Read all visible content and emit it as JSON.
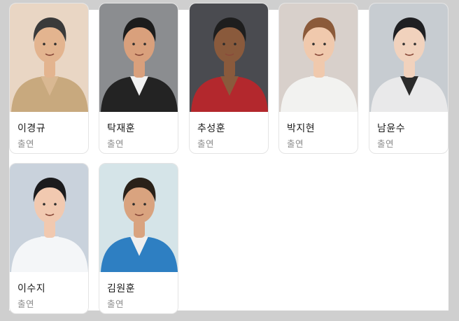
{
  "cast": [
    {
      "name": "이경규",
      "role": "출연",
      "colors": {
        "bg": "#e9d6c4",
        "skin": "#e3b48f",
        "hair": "#3a3a3a",
        "top": "#c8a97e",
        "inner": "#d9b892"
      }
    },
    {
      "name": "탁재훈",
      "role": "출연",
      "colors": {
        "bg": "#8b8d90",
        "skin": "#d9a07c",
        "hair": "#1c1c1c",
        "top": "#232323",
        "inner": "#f1f1f1"
      }
    },
    {
      "name": "추성훈",
      "role": "출연",
      "colors": {
        "bg": "#4a4b50",
        "skin": "#8a5a3c",
        "hair": "#1e1e1e",
        "top": "#b3282d",
        "inner": "#8a5a3c"
      }
    },
    {
      "name": "박지현",
      "role": "출연",
      "colors": {
        "bg": "#d8d0cb",
        "skin": "#f0c9ad",
        "hair": "#8b5a3a",
        "top": "#f2f2f0",
        "inner": "#f2f2f0"
      }
    },
    {
      "name": "남윤수",
      "role": "출연",
      "colors": {
        "bg": "#c7ccd1",
        "skin": "#f1d2bd",
        "hair": "#1f1f22",
        "top": "#e9e9ea",
        "inner": "#2b2b2b"
      }
    },
    {
      "name": "이수지",
      "role": "출연",
      "colors": {
        "bg": "#c9d2dc",
        "skin": "#f1c9b0",
        "hair": "#1b1b1d",
        "top": "#f4f6f8",
        "inner": "#f4f6f8"
      }
    },
    {
      "name": "김원훈",
      "role": "출연",
      "colors": {
        "bg": "#d5e4e8",
        "skin": "#d9a37f",
        "hair": "#2a2119",
        "top": "#2e7fc2",
        "inner": "#efefef"
      }
    }
  ]
}
